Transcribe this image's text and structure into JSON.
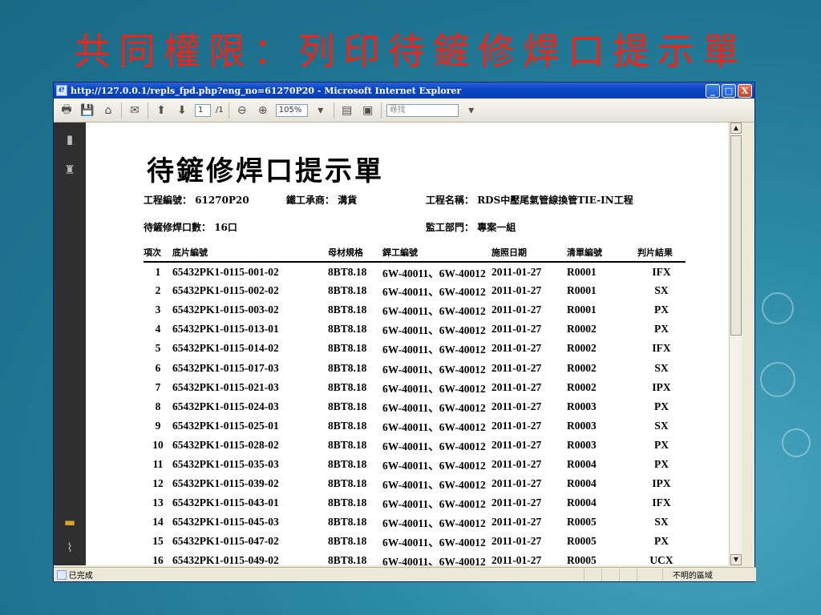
{
  "slide": {
    "title": "共同權限：列印待鏟修焊口提示單"
  },
  "window": {
    "title": "http://127.0.0.1/repls_fpd.php?eng_no=61270P20 - Microsoft Internet Explorer",
    "buttons": [
      "_",
      "□",
      "X"
    ]
  },
  "toolbar": {
    "page_current": "1",
    "page_total": "/1",
    "zoom": "105%",
    "find_placeholder": "尋找"
  },
  "status": {
    "text": "已完成",
    "zone": "不明的區域"
  },
  "document": {
    "title": "待鏟修焊口提示單",
    "project_no_label": "工程編號：",
    "project_no": "61270P20",
    "contractor_label": "鐵工承商：",
    "contractor": "溝貨",
    "project_name_label": "工程名稱：",
    "project_name": "RDS中壓尾氣管線換管TIE-IN工程",
    "weld_count_label": "待鏟修焊口數：",
    "weld_count": "16口",
    "supervise_label": "監工部門：",
    "supervise": "專案一組",
    "columns": [
      "項次",
      "底片編號",
      "母材規格",
      "銲工編號",
      "施照日期",
      "清單編號",
      "判片結果"
    ],
    "rows": [
      [
        "1",
        "65432PK1-0115-001-02",
        "8BT8.18",
        "6W-40011、6W-40012",
        "2011-01-27",
        "R0001",
        "IFX"
      ],
      [
        "2",
        "65432PK1-0115-002-02",
        "8BT8.18",
        "6W-40011、6W-40012",
        "2011-01-27",
        "R0001",
        "SX"
      ],
      [
        "3",
        "65432PK1-0115-003-02",
        "8BT8.18",
        "6W-40011、6W-40012",
        "2011-01-27",
        "R0001",
        "PX"
      ],
      [
        "4",
        "65432PK1-0115-013-01",
        "8BT8.18",
        "6W-40011、6W-40012",
        "2011-01-27",
        "R0002",
        "PX"
      ],
      [
        "5",
        "65432PK1-0115-014-02",
        "8BT8.18",
        "6W-40011、6W-40012",
        "2011-01-27",
        "R0002",
        "IFX"
      ],
      [
        "6",
        "65432PK1-0115-017-03",
        "8BT8.18",
        "6W-40011、6W-40012",
        "2011-01-27",
        "R0002",
        "SX"
      ],
      [
        "7",
        "65432PK1-0115-021-03",
        "8BT8.18",
        "6W-40011、6W-40012",
        "2011-01-27",
        "R0002",
        "IPX"
      ],
      [
        "8",
        "65432PK1-0115-024-03",
        "8BT8.18",
        "6W-40011、6W-40012",
        "2011-01-27",
        "R0003",
        "PX"
      ],
      [
        "9",
        "65432PK1-0115-025-01",
        "8BT8.18",
        "6W-40011、6W-40012",
        "2011-01-27",
        "R0003",
        "SX"
      ],
      [
        "10",
        "65432PK1-0115-028-02",
        "8BT8.18",
        "6W-40011、6W-40012",
        "2011-01-27",
        "R0003",
        "PX"
      ],
      [
        "11",
        "65432PK1-0115-035-03",
        "8BT8.18",
        "6W-40011、6W-40012",
        "2011-01-27",
        "R0004",
        "PX"
      ],
      [
        "12",
        "65432PK1-0115-039-02",
        "8BT8.18",
        "6W-40011、6W-40012",
        "2011-01-27",
        "R0004",
        "IPX"
      ],
      [
        "13",
        "65432PK1-0115-043-01",
        "8BT8.18",
        "6W-40011、6W-40012",
        "2011-01-27",
        "R0004",
        "IFX"
      ],
      [
        "14",
        "65432PK1-0115-045-03",
        "8BT8.18",
        "6W-40011、6W-40012",
        "2011-01-27",
        "R0005",
        "SX"
      ],
      [
        "15",
        "65432PK1-0115-047-02",
        "8BT8.18",
        "6W-40011、6W-40012",
        "2011-01-27",
        "R0005",
        "PX"
      ],
      [
        "16",
        "65432PK1-0115-049-02",
        "8BT8.18",
        "6W-40011、6W-40012",
        "2011-01-27",
        "R0005",
        "UCX"
      ]
    ]
  },
  "colors": {
    "slide_title": "#e8261a",
    "slide_background": "#1f7491",
    "titlebar": "#0a46c4"
  }
}
